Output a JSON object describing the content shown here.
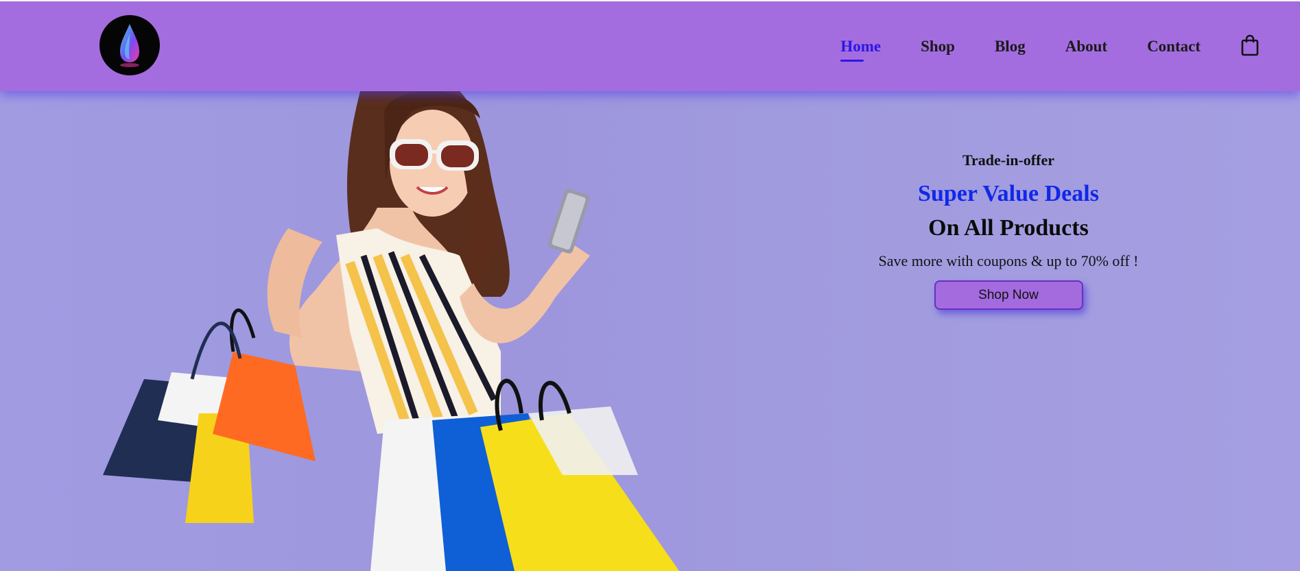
{
  "header": {
    "logo_icon": "flame-drop-icon",
    "nav": [
      {
        "label": "Home",
        "active": true
      },
      {
        "label": "Shop",
        "active": false
      },
      {
        "label": "Blog",
        "active": false
      },
      {
        "label": "About",
        "active": false
      },
      {
        "label": "Contact",
        "active": false
      }
    ],
    "cart_icon": "shopping-bag-icon"
  },
  "hero": {
    "image": "woman-with-shopping-bags-and-phone",
    "kicker": "Trade-in-offer",
    "title": "Super Value Deals",
    "subtitle": "On All Products",
    "description": "Save more with coupons & up to 70% off !",
    "cta_label": "Shop Now"
  },
  "colors": {
    "header_bg": "#a46ddf",
    "hero_bg": "#a19ce2",
    "accent_blue": "#1028e8",
    "button_bg": "#a36bde"
  }
}
